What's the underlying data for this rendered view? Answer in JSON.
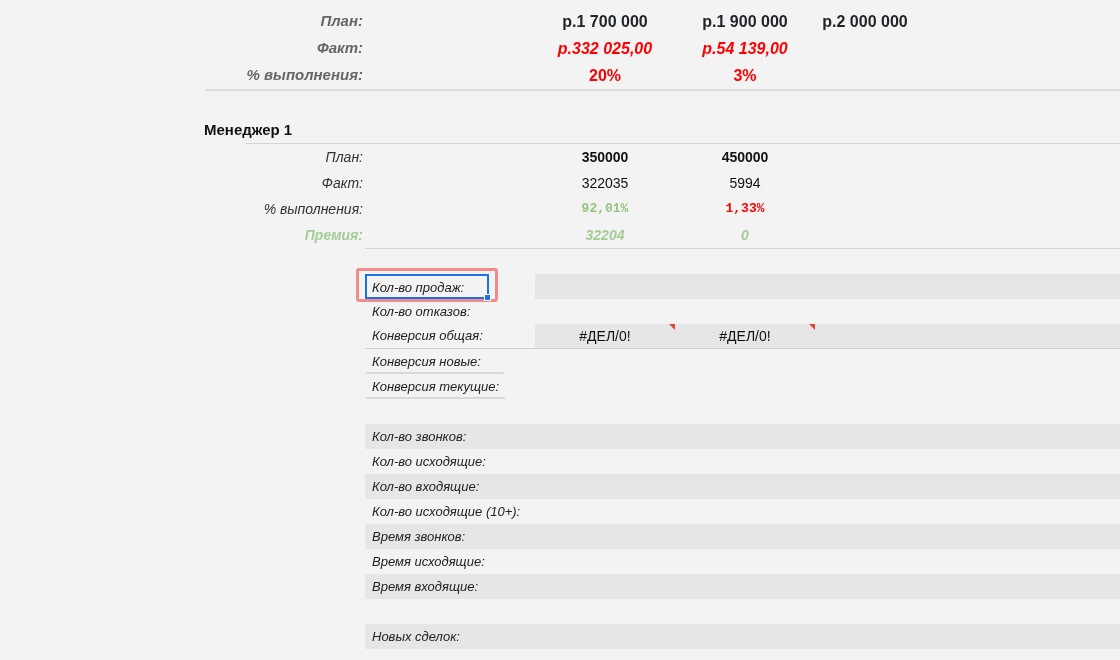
{
  "department": {
    "rows": [
      {
        "kind": "plan",
        "label": "План:",
        "values": [
          {
            "text": "р.1 700 000"
          },
          {
            "text": "р.1 900 000"
          },
          {
            "text": "р.2 000 000"
          }
        ]
      },
      {
        "kind": "fact",
        "label": "Факт:",
        "values": [
          {
            "text": "р.332 025,00"
          },
          {
            "text": "р.54 139,00"
          }
        ]
      },
      {
        "kind": "percent",
        "label": "% выполнения:",
        "values": [
          {
            "text": "20%"
          },
          {
            "text": "3%"
          }
        ]
      }
    ]
  },
  "manager": {
    "title": "Менеджер 1",
    "rows": [
      {
        "kind": "plan",
        "label": "План:",
        "values": [
          {
            "text": "350000"
          },
          {
            "text": "450000"
          }
        ]
      },
      {
        "kind": "fact",
        "label": "Факт:",
        "values": [
          {
            "text": "322035"
          },
          {
            "text": "5994"
          }
        ]
      },
      {
        "kind": "percent",
        "label": "% выполнения:",
        "values": [
          {
            "text": "92,01%",
            "color": "#93c47d"
          },
          {
            "text": "1,33%",
            "color": "#ff0000"
          }
        ]
      },
      {
        "kind": "bonus",
        "label": "Премия:",
        "values": [
          {
            "text": "32204"
          },
          {
            "text": "0"
          }
        ]
      }
    ]
  },
  "metric_groups": [
    {
      "full_row_bands": false,
      "rows": [
        {
          "label": "Кол-во продаж:",
          "selected": true,
          "shaded": true,
          "rule_full": false,
          "rule_label": false
        },
        {
          "label": "Кол-во отказов:",
          "selected": false,
          "shaded": false,
          "rule_full": false,
          "rule_label": false
        },
        {
          "label": "Конверсия общая:",
          "selected": false,
          "shaded": true,
          "rule_full": true,
          "rule_label": false,
          "values": [
            {
              "text": "#ДЕЛ/0!",
              "comment": true
            },
            {
              "text": "#ДЕЛ/0!",
              "comment": true
            }
          ]
        },
        {
          "label": "Конверсия новые:",
          "selected": false,
          "shaded": false,
          "rule_full": false,
          "rule_label": true
        },
        {
          "label": "Конверсия текущие:",
          "selected": false,
          "shaded": false,
          "rule_full": false,
          "rule_label": true
        }
      ]
    },
    {
      "full_row_bands": true,
      "rows": [
        {
          "label": "Кол-во звонков:",
          "selected": false,
          "shaded": true
        },
        {
          "label": "Кол-во исходящие:",
          "selected": false,
          "shaded": false
        },
        {
          "label": "Кол-во входящие:",
          "selected": false,
          "shaded": true
        },
        {
          "label": "Кол-во исходящие (10+):",
          "selected": false,
          "shaded": false
        },
        {
          "label": "Время звонков:",
          "selected": false,
          "shaded": true
        },
        {
          "label": "Время исходящие:",
          "selected": false,
          "shaded": false
        },
        {
          "label": "Время входящие:",
          "selected": false,
          "shaded": true
        }
      ]
    },
    {
      "full_row_bands": true,
      "rows": [
        {
          "label": "Новых сделок:",
          "selected": false,
          "shaded": true
        }
      ]
    }
  ]
}
